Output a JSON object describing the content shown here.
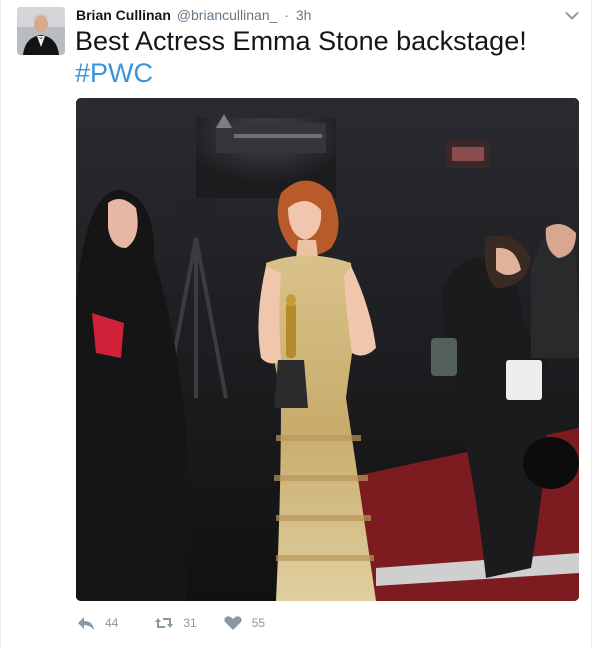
{
  "tweet": {
    "author": {
      "name": "Brian Cullinan",
      "handle": "@briancullinan_",
      "separator": "·",
      "time": "3h"
    },
    "text": "Best Actress Emma Stone backstage!",
    "hashtag": "#PWC",
    "media_icon": "photo",
    "stats": {
      "replies": "44",
      "retweets": "31",
      "likes": "55"
    }
  },
  "colors": {
    "link": "#3b94d9",
    "meta": "#657786",
    "action": "#8899a6"
  }
}
